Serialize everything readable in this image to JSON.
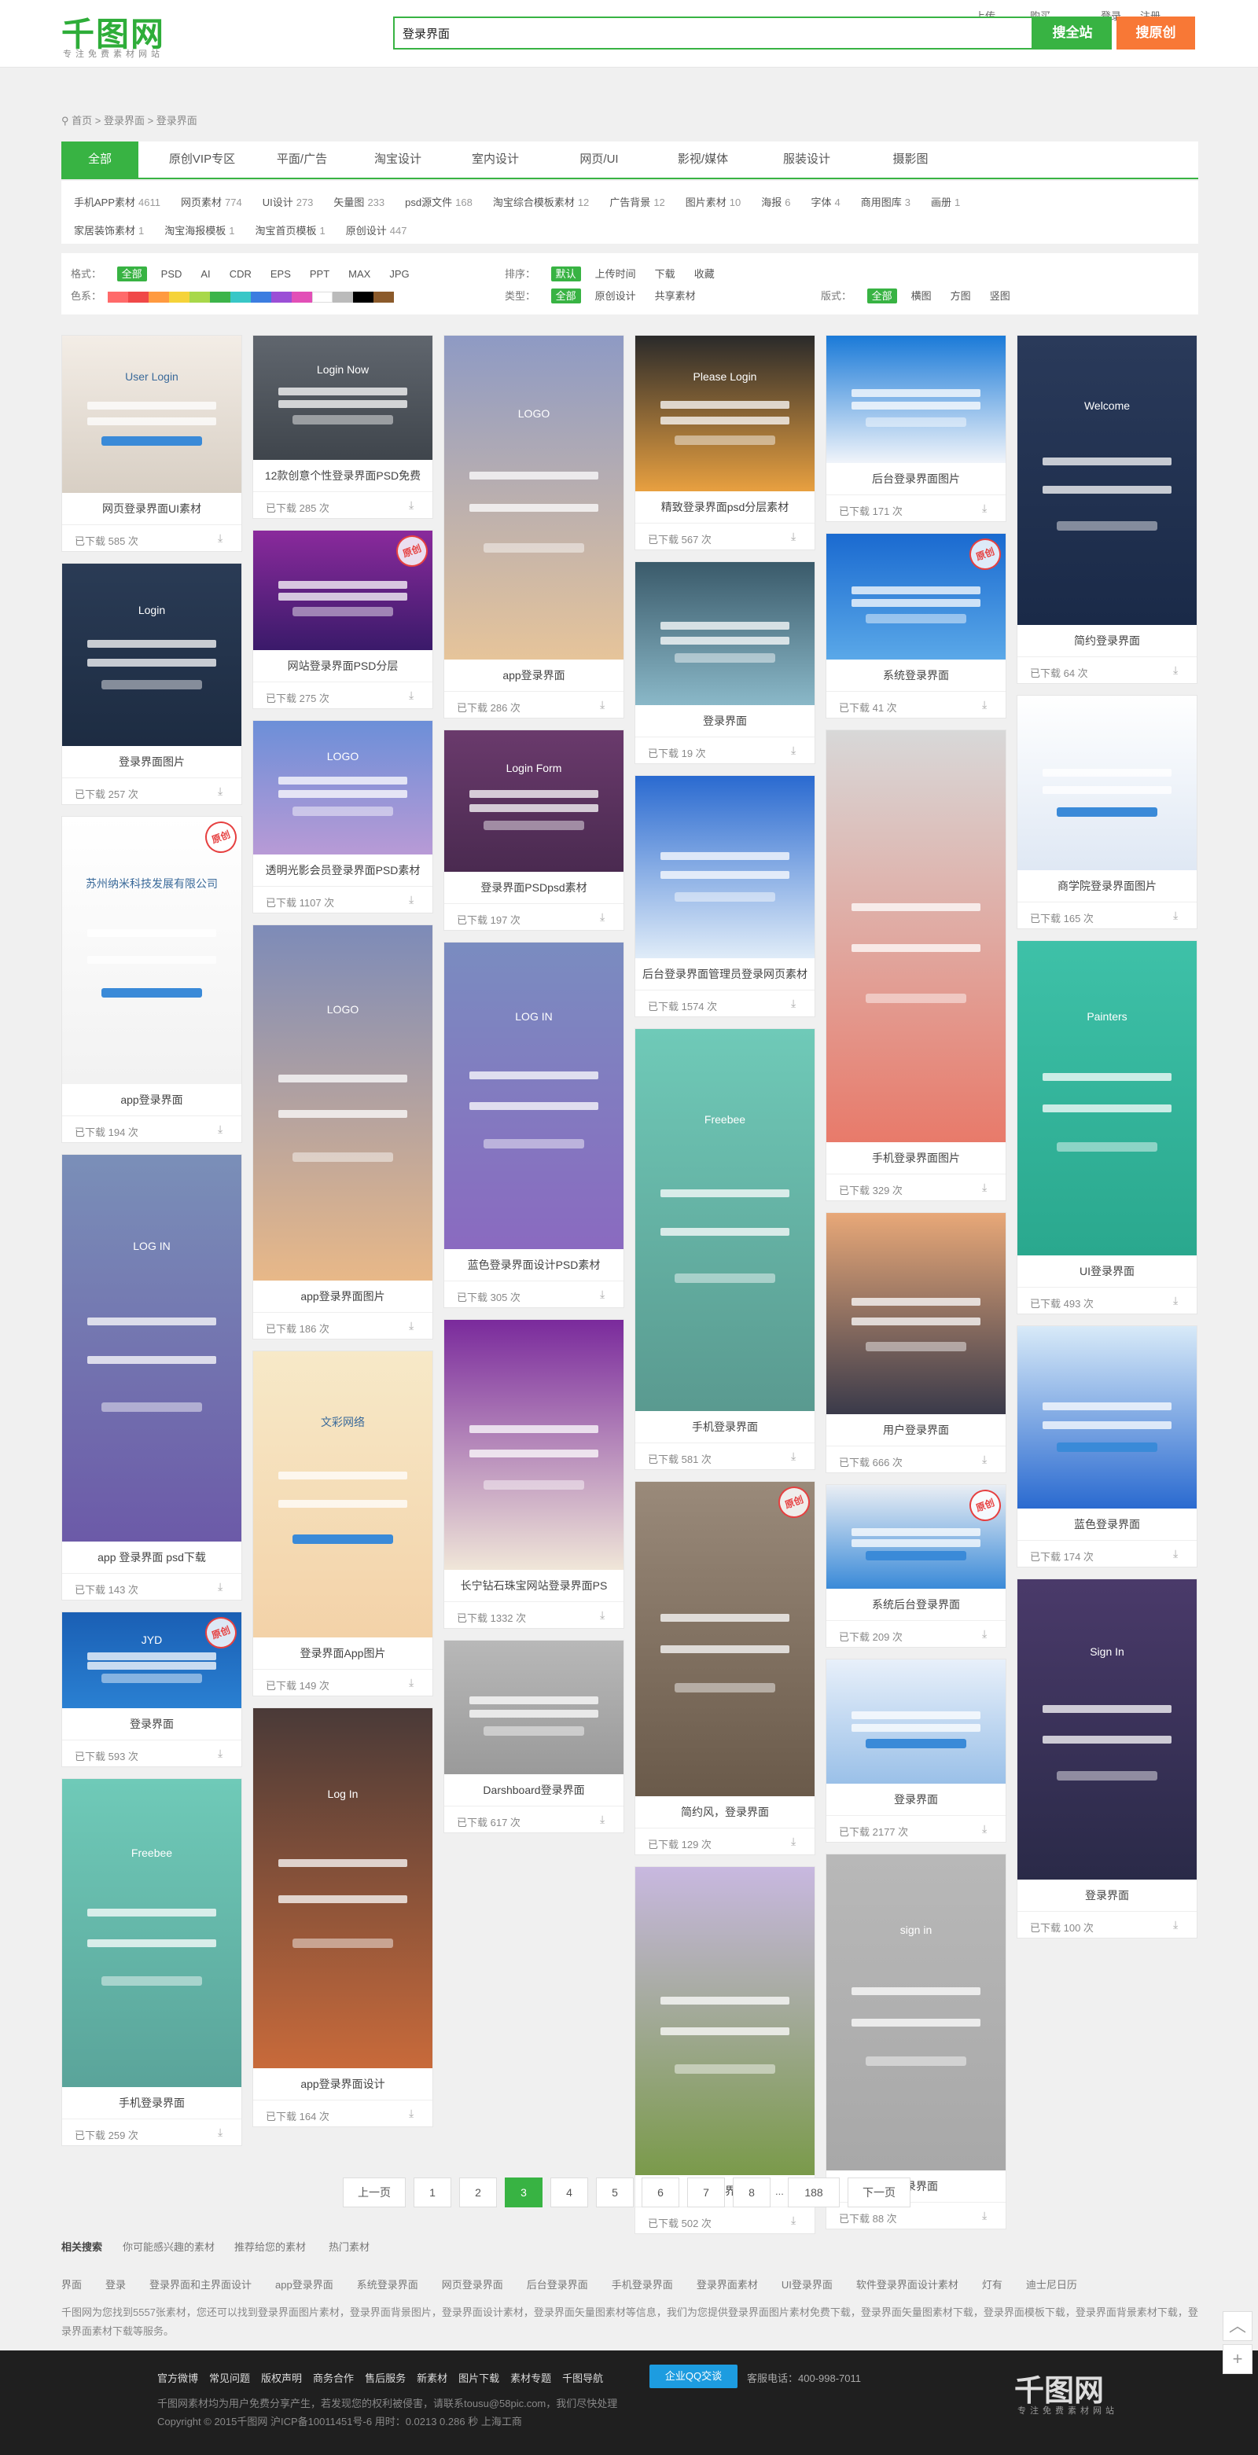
{
  "header": {
    "logo": "千图网",
    "logo_sub": "专注免费素材网站",
    "search_value": "登录界面",
    "search_all_label": "搜全站",
    "search_orig_label": "搜原创",
    "top_links": [
      "上传",
      "购买",
      "登录",
      "注册"
    ]
  },
  "breadcrumb": "首页 > 登录界面 > 登录界面",
  "cattabs": [
    "全部",
    "原创VIP专区",
    "平面/广告",
    "淘宝设计",
    "室内设计",
    "网页/UI",
    "影视/媒体",
    "服装设计",
    "摄影图"
  ],
  "subcats": [
    {
      "name": "手机APP素材",
      "n": "4611"
    },
    {
      "name": "网页素材",
      "n": "774"
    },
    {
      "name": "UI设计",
      "n": "273"
    },
    {
      "name": "矢量图",
      "n": "233"
    },
    {
      "name": "psd源文件",
      "n": "168"
    },
    {
      "name": "淘宝综合模板素材",
      "n": "12"
    },
    {
      "name": "广告背景",
      "n": "12"
    },
    {
      "name": "图片素材",
      "n": "10"
    },
    {
      "name": "海报",
      "n": "6"
    },
    {
      "name": "字体",
      "n": "4"
    },
    {
      "name": "商用图库",
      "n": "3"
    },
    {
      "name": "画册",
      "n": "1"
    },
    {
      "name": "家居装饰素材",
      "n": "1"
    },
    {
      "name": "淘宝海报模板",
      "n": "1"
    },
    {
      "name": "淘宝首页模板",
      "n": "1"
    },
    {
      "name": "原创设计",
      "n": "447"
    }
  ],
  "filters": {
    "format_label": "格式：",
    "formats": [
      "全部",
      "PSD",
      "AI",
      "CDR",
      "EPS",
      "PPT",
      "MAX",
      "JPG"
    ],
    "color_label": "色系：",
    "colors": [
      "#ff6a6a",
      "#f04848",
      "#ff9a40",
      "#f5d33a",
      "#a8d84a",
      "#3cb44a",
      "#38c7c7",
      "#3c7de0",
      "#9b4fd6",
      "#e24fb7",
      "#ffffff",
      "#bbbbbb",
      "#000000",
      "#8b5a2b"
    ],
    "sort_label": "排序：",
    "sorts": [
      "默认",
      "上传时间",
      "下载",
      "收藏"
    ],
    "type_label": "类型：",
    "types": [
      "全部",
      "原创设计",
      "共享素材"
    ],
    "layout_label": "版式：",
    "layouts": [
      "全部",
      "横图",
      "方图",
      "竖图"
    ]
  },
  "download_prefix": "已下载",
  "download_suffix": "次",
  "cards": [
    {
      "title": "网页登录界面UI素材",
      "downloads": "585",
      "c1": "#f3ede6",
      "c2": "#d8cfc4",
      "mock": "User Login"
    },
    {
      "title": "登录界面图片",
      "downloads": "257",
      "c1": "#2a3b55",
      "c2": "#1d2c42",
      "mock": "Login"
    },
    {
      "title": "app登录界面",
      "downloads": "194",
      "c1": "#ffffff",
      "c2": "#f2f2f2",
      "mock": "苏州纳米科技发展有限公司",
      "badge": "原创"
    },
    {
      "title": "app 登录界面 psd下载",
      "downloads": "143",
      "c1": "#7a8fb8",
      "c2": "#6c5aa8",
      "mock": "LOG IN"
    },
    {
      "title": "登录界面",
      "downloads": "593",
      "c1": "#1a5fb4",
      "c2": "#2a80d2",
      "mock": "JYD",
      "badge": "原创"
    },
    {
      "title": "手机登录界面",
      "downloads": "259",
      "c1": "#6fcab8",
      "c2": "#5aa49a",
      "mock": "Freebee"
    },
    {
      "title": "12款创意个性登录界面PSD免费",
      "downloads": "285",
      "c1": "#60666e",
      "c2": "#3f454c",
      "mock": "Login Now"
    },
    {
      "title": "网站登录界面PSD分层",
      "downloads": "275",
      "c1": "#8a2a9c",
      "c2": "#3a1a6a",
      "mock": "",
      "badge": "原创"
    },
    {
      "title": "透明光影会员登录界面PSD素材",
      "downloads": "1107",
      "c1": "#6c8fd8",
      "c2": "#b89ad6",
      "mock": "LOGO"
    },
    {
      "title": "app登录界面图片",
      "downloads": "186",
      "c1": "#7d8bb8",
      "c2": "#e8b888",
      "mock": "LOGO"
    },
    {
      "title": "登录界面App图片",
      "downloads": "149",
      "c1": "#f7e9c8",
      "c2": "#f3d2a8",
      "mock": "文彩网络"
    },
    {
      "title": "app登录界面设计",
      "downloads": "164",
      "c1": "#4a3a38",
      "c2": "#c86a3a",
      "mock": "Log In"
    },
    {
      "title": "app登录界面",
      "downloads": "286",
      "c1": "#8e9ac4",
      "c2": "#e6c49a",
      "mock": "LOGO"
    },
    {
      "title": "登录界面PSDpsd素材",
      "downloads": "197",
      "c1": "#6a3a6c",
      "c2": "#4a2a50",
      "mock": "Login Form"
    },
    {
      "title": "蓝色登录界面设计PSD素材",
      "downloads": "305",
      "c1": "#7a8cc0",
      "c2": "#8a6ac0",
      "mock": "LOG IN"
    },
    {
      "title": "长宁钻石珠宝网站登录界面PS",
      "downloads": "1332",
      "c1": "#7a2a9c",
      "c2": "#f0e6d8",
      "mock": ""
    },
    {
      "title": "Darshboard登录界面",
      "downloads": "617",
      "c1": "#b8b8b8",
      "c2": "#9a9a9a",
      "mock": ""
    },
    {
      "title": "精致登录界面psd分层素材",
      "downloads": "567",
      "c1": "#2a2a2a",
      "c2": "#e8a040",
      "mock": "Please Login"
    },
    {
      "title": "登录界面",
      "downloads": "19",
      "c1": "#3a5a6a",
      "c2": "#8ab8c8",
      "mock": ""
    },
    {
      "title": "后台登录界面管理员登录网页素材",
      "downloads": "1574",
      "c1": "#2a6ad0",
      "c2": "#e0ecf8",
      "mock": ""
    },
    {
      "title": "手机登录界面",
      "downloads": "581",
      "c1": "#6fcab8",
      "c2": "#5a9a90",
      "mock": "Freebee"
    },
    {
      "title": "简约风，登录界面",
      "downloads": "129",
      "c1": "#9a8a7a",
      "c2": "#6a5a4a",
      "mock": "",
      "badge": "原创"
    },
    {
      "title": "登录界面",
      "downloads": "502",
      "c1": "#c8b8e0",
      "c2": "#7a9a4a",
      "mock": ""
    },
    {
      "title": "后台登录界面图片",
      "downloads": "171",
      "c1": "#1a7ad8",
      "c2": "#f0f4fa",
      "mock": ""
    },
    {
      "title": "系统登录界面",
      "downloads": "41",
      "c1": "#1a6ad0",
      "c2": "#5aa8e8",
      "mock": "",
      "badge": "原创"
    },
    {
      "title": "手机登录界面图片",
      "downloads": "329",
      "c1": "#d8d8d8",
      "c2": "#e87a6a",
      "mock": ""
    },
    {
      "title": "用户登录界面",
      "downloads": "666",
      "c1": "#e8a878",
      "c2": "#3a3a4a",
      "mock": ""
    },
    {
      "title": "系统后台登录界面",
      "downloads": "209",
      "c1": "#eaeef4",
      "c2": "#3a8ad8",
      "mock": "",
      "badge": "原创"
    },
    {
      "title": "登录界面",
      "downloads": "2177",
      "c1": "#e8f0fa",
      "c2": "#9ac0e8",
      "mock": ""
    },
    {
      "title": "登录界面",
      "downloads": "88",
      "c1": "#b8b8b8",
      "c2": "#a8a8a8",
      "mock": "sign in"
    },
    {
      "title": "简约登录界面",
      "downloads": "64",
      "c1": "#2a3a5a",
      "c2": "#1a2a48",
      "mock": "Welcome"
    },
    {
      "title": "商学院登录界面图片",
      "downloads": "165",
      "c1": "#ffffff",
      "c2": "#dfe8f4",
      "mock": ""
    },
    {
      "title": "UI登录界面",
      "downloads": "493",
      "c1": "#3ec1a8",
      "c2": "#2aa88e",
      "mock": "Painters"
    },
    {
      "title": "蓝色登录界面",
      "downloads": "174",
      "c1": "#d8eaf8",
      "c2": "#2a6ad0",
      "mock": ""
    },
    {
      "title": "登录界面",
      "downloads": "100",
      "c1": "#4a3a6a",
      "c2": "#2a2a48",
      "mock": "Sign In"
    }
  ],
  "pagination": {
    "prev": "上一页",
    "pages": [
      "1",
      "2",
      "3",
      "4",
      "5",
      "6",
      "7",
      "8"
    ],
    "ellipsis": "...",
    "last": "188",
    "next": "下一页",
    "current": "3"
  },
  "related": {
    "tabs": [
      "相关搜索",
      "你可能感兴趣的素材",
      "推荐给您的素材",
      "热门素材"
    ],
    "keywords": [
      "界面",
      "登录",
      "登录界面和主界面设计",
      "app登录界面",
      "系统登录界面",
      "网页登录界面",
      "后台登录界面",
      "手机登录界面",
      "登录界面素材",
      "UI登录界面",
      "软件登录界面设计素材",
      "灯有",
      "迪士尼日历"
    ],
    "desc": "千图网为您找到5557张素材，您还可以找到登录界面图片素材，登录界面背景图片，登录界面设计素材，登录界面矢量图素材等信息，我们为您提供登录界面图片素材免费下载，登录界面矢量图素材下载，登录界面模板下载，登录界面背景素材下载，登录界面素材下载等服务。"
  },
  "footer": {
    "links": [
      "官方微博",
      "常见问题",
      "版权声明",
      "商务合作",
      "售后服务",
      "新素材",
      "图片下载",
      "素材专题",
      "千图导航"
    ],
    "qq": "企业QQ交谈",
    "phone": "客服电话：400-998-7011",
    "line2": "千图网素材均为用户免费分享产生，若发现您的权利被侵害，请联系tousu@58pic.com，我们尽快处理",
    "line3": "Copyright © 2015千图网 沪ICP备10011451号-6 用时：0.0213 0.286 秒  上海工商",
    "logo": "千图网",
    "logo_sub": "专注免费素材网站"
  },
  "side_buttons": [
    "︿",
    "+"
  ]
}
